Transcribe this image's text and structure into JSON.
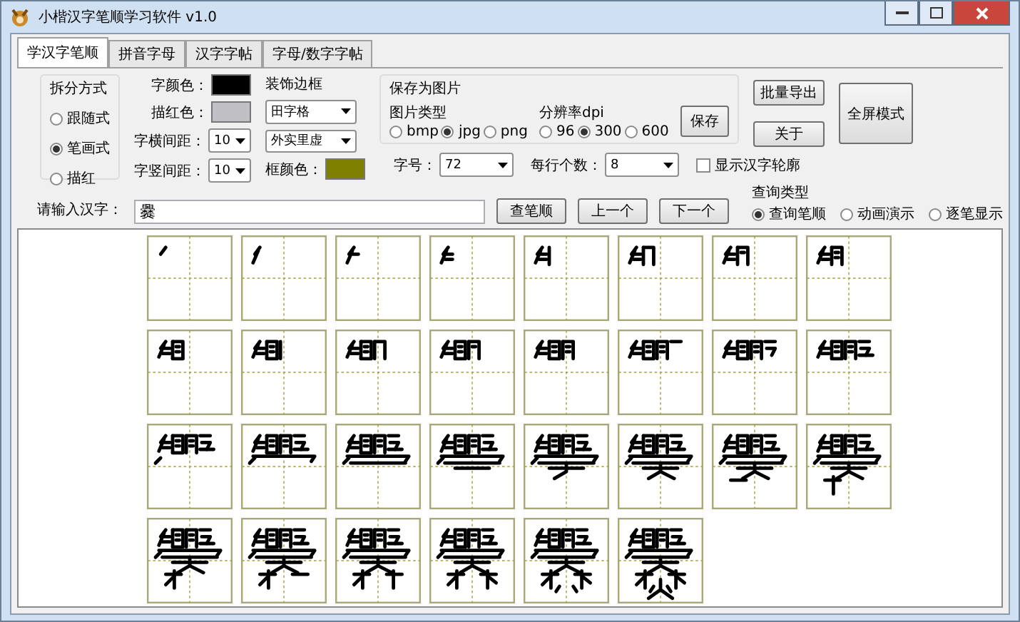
{
  "window": {
    "title": "小楷汉字笔顺学习软件 v1.0"
  },
  "tabs": [
    {
      "label": "学汉字笔顺",
      "selected": true
    },
    {
      "label": "拼音字母",
      "selected": false
    },
    {
      "label": "汉字字帖",
      "selected": false
    },
    {
      "label": "字母/数字字帖",
      "selected": false
    }
  ],
  "split_mode": {
    "title": "拆分方式",
    "options": [
      {
        "label": "跟随式",
        "selected": false
      },
      {
        "label": "笔画式",
        "selected": true
      },
      {
        "label": "描红",
        "selected": false
      }
    ]
  },
  "colors": [
    {
      "label": "字颜色：",
      "color": "#000000"
    },
    {
      "label": "描红色：",
      "color": "#c0c0c4"
    }
  ],
  "spacing": [
    {
      "label": "字横间距：",
      "value": "10"
    },
    {
      "label": "字竖间距：",
      "value": "10"
    }
  ],
  "decoration": {
    "title": "装饰边框",
    "dropdowns": [
      "田字格",
      "外实里虚"
    ],
    "frame_color": {
      "label": "框颜色：",
      "color": "#808000"
    }
  },
  "save_image": {
    "title": "保存为图片",
    "type_label": "图片类型",
    "types": [
      {
        "label": "bmp",
        "selected": false
      },
      {
        "label": "jpg",
        "selected": true
      },
      {
        "label": "png",
        "selected": false
      }
    ],
    "dpi_label": "分辨率dpi",
    "dpis": [
      {
        "label": "96",
        "selected": false
      },
      {
        "label": "300",
        "selected": true
      },
      {
        "label": "600",
        "selected": false
      }
    ],
    "save_button": "保存"
  },
  "font_size": {
    "label": "字号：",
    "value": "72"
  },
  "per_row": {
    "label": "每行个数：",
    "value": "8"
  },
  "outline": {
    "label": "显示汉字轮廓",
    "checked": false
  },
  "buttons": {
    "export": "批量导出",
    "about": "关于",
    "fullscreen": "全屏模式"
  },
  "input": {
    "label": "请输入汉字：",
    "value": "爨"
  },
  "nav_buttons": [
    "查笔顺",
    "上一个",
    "下一个"
  ],
  "query_type": {
    "title": "查询类型",
    "options": [
      {
        "label": "查询笔顺",
        "selected": true
      },
      {
        "label": "动画演示",
        "selected": false
      },
      {
        "label": "逐笔显示",
        "selected": false
      }
    ]
  },
  "stroke_cells": [
    {
      "kind": "stroke-step"
    },
    {
      "kind": "stroke-step"
    },
    {
      "kind": "stroke-step"
    },
    {
      "kind": "stroke-step"
    },
    {
      "kind": "stroke-step"
    },
    {
      "kind": "stroke-step"
    },
    {
      "kind": "stroke-step"
    },
    {
      "kind": "stroke-step"
    },
    {
      "kind": "stroke-step"
    },
    {
      "kind": "stroke-step"
    },
    {
      "kind": "stroke-step"
    },
    {
      "kind": "stroke-step"
    },
    {
      "kind": "stroke-step"
    },
    {
      "kind": "stroke-step"
    },
    {
      "kind": "stroke-step"
    },
    {
      "kind": "stroke-step"
    },
    {
      "kind": "stroke-step"
    },
    {
      "kind": "stroke-step"
    },
    {
      "kind": "stroke-step"
    },
    {
      "kind": "stroke-step"
    },
    {
      "kind": "stroke-step"
    },
    {
      "kind": "stroke-step"
    },
    {
      "kind": "stroke-step"
    },
    {
      "kind": "stroke-step"
    },
    {
      "kind": "stroke-step"
    },
    {
      "kind": "stroke-step"
    },
    {
      "kind": "stroke-step"
    },
    {
      "kind": "stroke-step"
    },
    {
      "kind": "stroke-step"
    },
    {
      "kind": "stroke-step"
    }
  ]
}
